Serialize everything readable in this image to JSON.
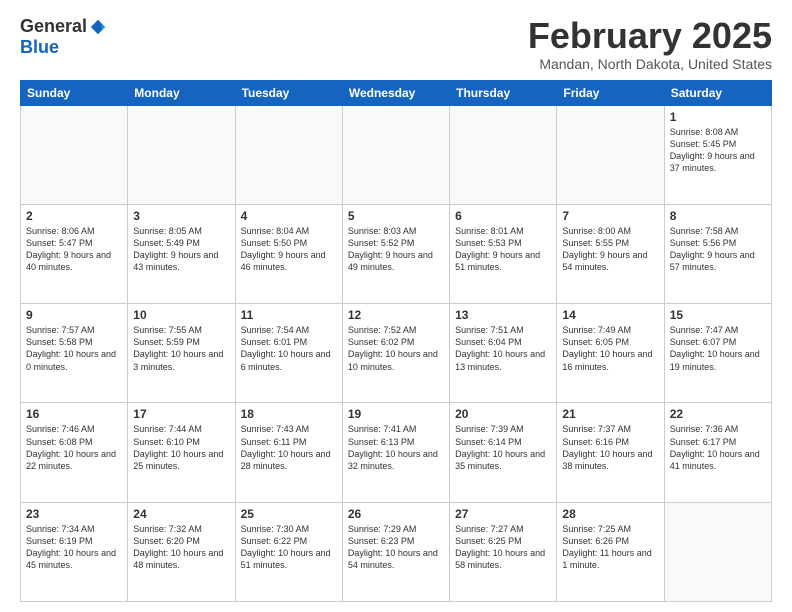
{
  "header": {
    "logo_general": "General",
    "logo_blue": "Blue",
    "month_title": "February 2025",
    "location": "Mandan, North Dakota, United States"
  },
  "days_of_week": [
    "Sunday",
    "Monday",
    "Tuesday",
    "Wednesday",
    "Thursday",
    "Friday",
    "Saturday"
  ],
  "weeks": [
    [
      {
        "day": "",
        "info": ""
      },
      {
        "day": "",
        "info": ""
      },
      {
        "day": "",
        "info": ""
      },
      {
        "day": "",
        "info": ""
      },
      {
        "day": "",
        "info": ""
      },
      {
        "day": "",
        "info": ""
      },
      {
        "day": "1",
        "info": "Sunrise: 8:08 AM\nSunset: 5:45 PM\nDaylight: 9 hours and 37 minutes."
      }
    ],
    [
      {
        "day": "2",
        "info": "Sunrise: 8:06 AM\nSunset: 5:47 PM\nDaylight: 9 hours and 40 minutes."
      },
      {
        "day": "3",
        "info": "Sunrise: 8:05 AM\nSunset: 5:49 PM\nDaylight: 9 hours and 43 minutes."
      },
      {
        "day": "4",
        "info": "Sunrise: 8:04 AM\nSunset: 5:50 PM\nDaylight: 9 hours and 46 minutes."
      },
      {
        "day": "5",
        "info": "Sunrise: 8:03 AM\nSunset: 5:52 PM\nDaylight: 9 hours and 49 minutes."
      },
      {
        "day": "6",
        "info": "Sunrise: 8:01 AM\nSunset: 5:53 PM\nDaylight: 9 hours and 51 minutes."
      },
      {
        "day": "7",
        "info": "Sunrise: 8:00 AM\nSunset: 5:55 PM\nDaylight: 9 hours and 54 minutes."
      },
      {
        "day": "8",
        "info": "Sunrise: 7:58 AM\nSunset: 5:56 PM\nDaylight: 9 hours and 57 minutes."
      }
    ],
    [
      {
        "day": "9",
        "info": "Sunrise: 7:57 AM\nSunset: 5:58 PM\nDaylight: 10 hours and 0 minutes."
      },
      {
        "day": "10",
        "info": "Sunrise: 7:55 AM\nSunset: 5:59 PM\nDaylight: 10 hours and 3 minutes."
      },
      {
        "day": "11",
        "info": "Sunrise: 7:54 AM\nSunset: 6:01 PM\nDaylight: 10 hours and 6 minutes."
      },
      {
        "day": "12",
        "info": "Sunrise: 7:52 AM\nSunset: 6:02 PM\nDaylight: 10 hours and 10 minutes."
      },
      {
        "day": "13",
        "info": "Sunrise: 7:51 AM\nSunset: 6:04 PM\nDaylight: 10 hours and 13 minutes."
      },
      {
        "day": "14",
        "info": "Sunrise: 7:49 AM\nSunset: 6:05 PM\nDaylight: 10 hours and 16 minutes."
      },
      {
        "day": "15",
        "info": "Sunrise: 7:47 AM\nSunset: 6:07 PM\nDaylight: 10 hours and 19 minutes."
      }
    ],
    [
      {
        "day": "16",
        "info": "Sunrise: 7:46 AM\nSunset: 6:08 PM\nDaylight: 10 hours and 22 minutes."
      },
      {
        "day": "17",
        "info": "Sunrise: 7:44 AM\nSunset: 6:10 PM\nDaylight: 10 hours and 25 minutes."
      },
      {
        "day": "18",
        "info": "Sunrise: 7:43 AM\nSunset: 6:11 PM\nDaylight: 10 hours and 28 minutes."
      },
      {
        "day": "19",
        "info": "Sunrise: 7:41 AM\nSunset: 6:13 PM\nDaylight: 10 hours and 32 minutes."
      },
      {
        "day": "20",
        "info": "Sunrise: 7:39 AM\nSunset: 6:14 PM\nDaylight: 10 hours and 35 minutes."
      },
      {
        "day": "21",
        "info": "Sunrise: 7:37 AM\nSunset: 6:16 PM\nDaylight: 10 hours and 38 minutes."
      },
      {
        "day": "22",
        "info": "Sunrise: 7:36 AM\nSunset: 6:17 PM\nDaylight: 10 hours and 41 minutes."
      }
    ],
    [
      {
        "day": "23",
        "info": "Sunrise: 7:34 AM\nSunset: 6:19 PM\nDaylight: 10 hours and 45 minutes."
      },
      {
        "day": "24",
        "info": "Sunrise: 7:32 AM\nSunset: 6:20 PM\nDaylight: 10 hours and 48 minutes."
      },
      {
        "day": "25",
        "info": "Sunrise: 7:30 AM\nSunset: 6:22 PM\nDaylight: 10 hours and 51 minutes."
      },
      {
        "day": "26",
        "info": "Sunrise: 7:29 AM\nSunset: 6:23 PM\nDaylight: 10 hours and 54 minutes."
      },
      {
        "day": "27",
        "info": "Sunrise: 7:27 AM\nSunset: 6:25 PM\nDaylight: 10 hours and 58 minutes."
      },
      {
        "day": "28",
        "info": "Sunrise: 7:25 AM\nSunset: 6:26 PM\nDaylight: 11 hours and 1 minute."
      },
      {
        "day": "",
        "info": ""
      }
    ]
  ]
}
